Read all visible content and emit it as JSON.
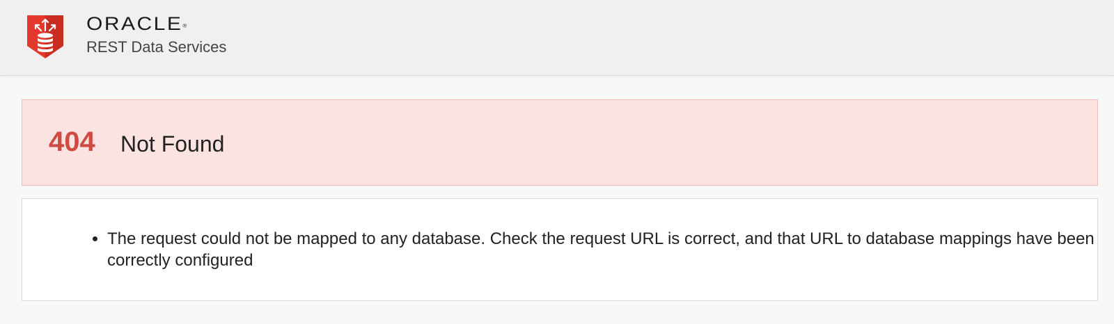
{
  "header": {
    "brand": "ORACLE",
    "trademark": "®",
    "subtitle": "REST Data Services",
    "logo_icon": "database-upload-shield-icon",
    "logo_color": "#e4382c"
  },
  "error": {
    "code": "404",
    "title": "Not Found",
    "code_color": "#cf4a3f",
    "panel_color": "#fbe3e2"
  },
  "messages": [
    "The request could not be mapped to any database. Check the request URL is correct, and that URL to database mappings have been correctly configured"
  ]
}
